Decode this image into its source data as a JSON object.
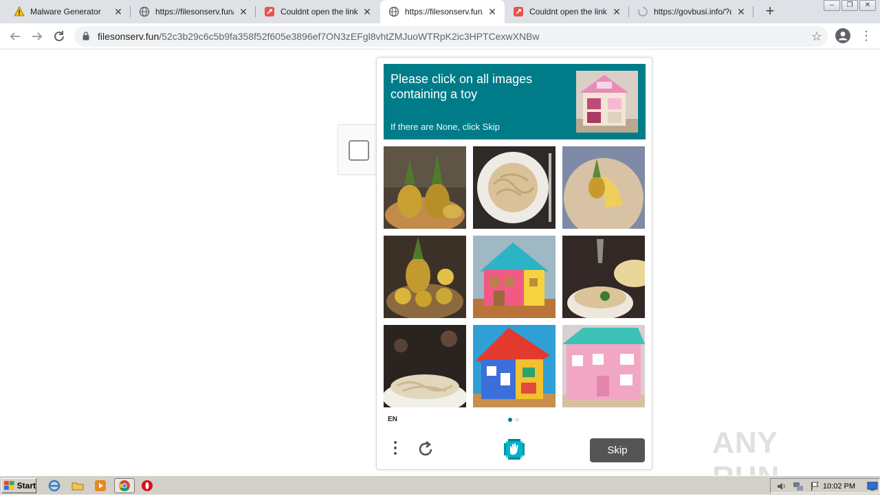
{
  "browser": {
    "tabs": [
      {
        "title": "Malware Generator",
        "icon": "warning-icon",
        "active": false
      },
      {
        "title": "https://filesonserv.fun/5",
        "icon": "globe-icon",
        "active": false
      },
      {
        "title": "Couldnt open the link",
        "icon": "red-app-icon",
        "active": false
      },
      {
        "title": "https://filesonserv.fun/5",
        "icon": "globe-icon",
        "active": true
      },
      {
        "title": "Couldnt open the link",
        "icon": "red-app-icon",
        "active": false
      },
      {
        "title": "https://govbusi.info/?dr",
        "icon": "loading-spinner-icon",
        "active": false
      }
    ],
    "new_tab_label": "+",
    "address": {
      "host": "filesonserv.fun",
      "path": "/52c3b29c6c5b9fa358f52f605e3896ef7ON3zEFgl8vhtZMJuoWTRpK2ic3HPTCexwXNBw"
    }
  },
  "captcha": {
    "prompt": "Please click on all images containing a toy",
    "subtext": "If there are None, click Skip",
    "language": "EN",
    "skip_label": "Skip",
    "accent_color": "#007c89",
    "page_dots": 2,
    "active_dot": 0,
    "images": [
      {
        "subject": "pineapples in basket",
        "kind": "pineapple"
      },
      {
        "subject": "pasta plate",
        "kind": "pasta"
      },
      {
        "subject": "pineapple slices on plate",
        "kind": "pineapple-plate"
      },
      {
        "subject": "pineapples in basket",
        "kind": "pineapple2"
      },
      {
        "subject": "toy house",
        "kind": "house1"
      },
      {
        "subject": "pasta dish",
        "kind": "pasta2"
      },
      {
        "subject": "pasta bowl",
        "kind": "pasta3"
      },
      {
        "subject": "toy house",
        "kind": "house2"
      },
      {
        "subject": "pink toy house",
        "kind": "house3"
      }
    ]
  },
  "watermark": "ANY RUN",
  "taskbar": {
    "start_label": "Start",
    "clock": "10:02 PM"
  }
}
